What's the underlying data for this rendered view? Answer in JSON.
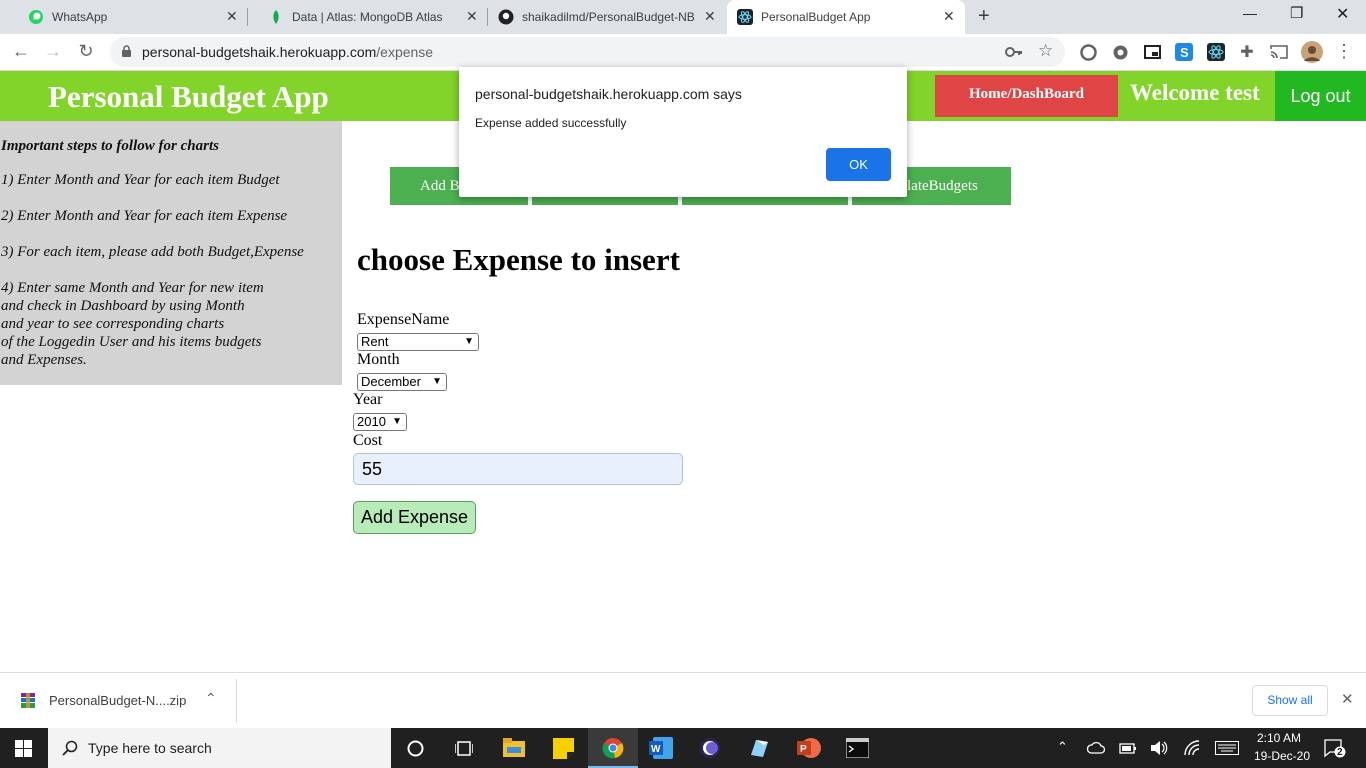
{
  "browser": {
    "tabs": [
      {
        "title": "WhatsApp",
        "icon": "whatsapp-icon"
      },
      {
        "title": "Data | Atlas: MongoDB Atlas",
        "icon": "mongodb-leaf-icon"
      },
      {
        "title": "shaikadilmd/PersonalBudget-NB",
        "icon": "github-icon"
      },
      {
        "title": "PersonalBudget App",
        "icon": "react-icon"
      }
    ],
    "url_host": "personal-budgetshaik.herokuapp.com",
    "url_path": "/expense"
  },
  "header": {
    "title": "Personal Budget App",
    "home_label": "Home/DashBoard",
    "welcome": "Welcome test",
    "logout_label": "Log out"
  },
  "sidebar": {
    "heading": "Important steps to follow for charts",
    "steps": [
      "1) Enter Month and Year for each item Budget",
      "2) Enter Month and Year for each item Expense",
      "3) For each item, please add both Budget,Expense"
    ],
    "step4_lines": [
      "4) Enter same Month and Year for new item",
      "and check in Dashboard by using Month",
      "and year to see corresponding charts",
      "of the Loggedin User and his items budgets",
      "and Expenses."
    ]
  },
  "nav": {
    "first_visible": "Add B",
    "last_visible": "lateBudgets"
  },
  "form": {
    "title": "choose Expense to insert",
    "expense_name_label": "ExpenseName",
    "expense_name_value": "Rent",
    "month_label": "Month",
    "month_value": "December",
    "year_label": "Year",
    "year_value": "2010",
    "cost_label": "Cost",
    "cost_value": "55",
    "submit_label": "Add Expense"
  },
  "dialog": {
    "title": "personal-budgetshaik.herokuapp.com says",
    "message": "Expense added successfully",
    "ok_label": "OK"
  },
  "download": {
    "file": "PersonalBudget-N....zip",
    "show_all": "Show all"
  },
  "taskbar": {
    "search_placeholder": "Type here to search",
    "time": "2:10 AM",
    "date": "19-Dec-20",
    "notifications": "2"
  },
  "colors": {
    "header_green": "#82d42a",
    "home_red": "#e04545",
    "logout_green": "#22b822",
    "nav_green": "#4caf50",
    "dialog_blue": "#1a73e8"
  }
}
